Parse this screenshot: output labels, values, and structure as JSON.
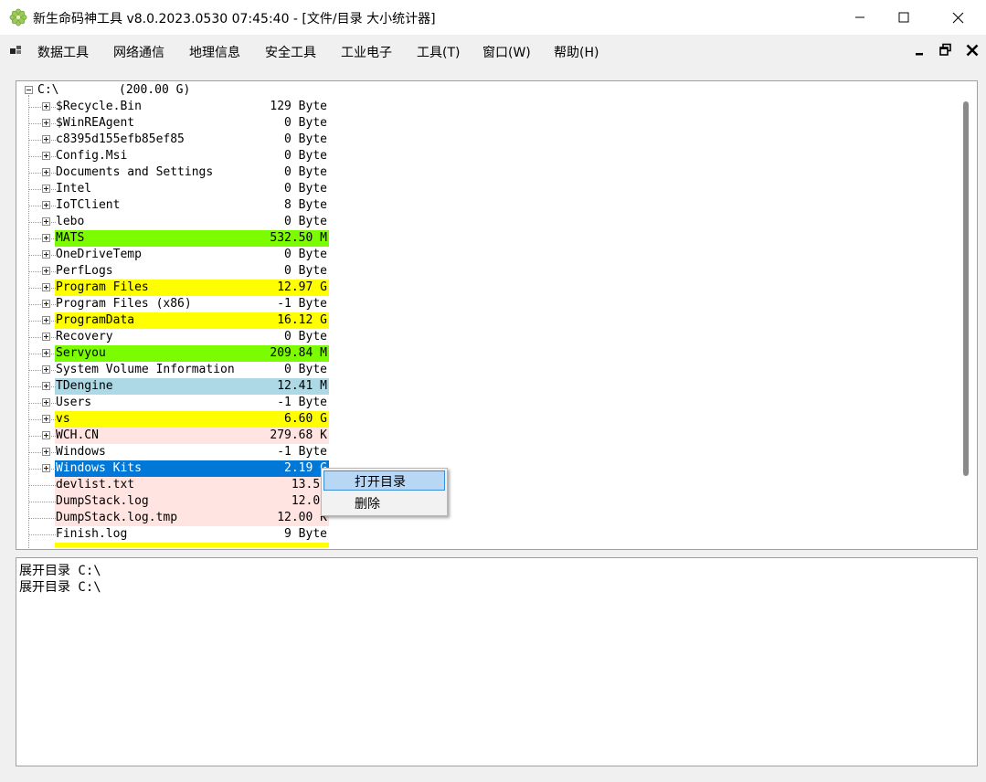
{
  "window": {
    "title": "新生命码神工具 v8.0.2023.0530 07:45:40 - [文件/目录 大小统计器]",
    "controls": [
      "minimize",
      "maximize",
      "close"
    ]
  },
  "menu": {
    "items": [
      "数据工具",
      "网络通信",
      "地理信息",
      "安全工具",
      "工业电子",
      "工具(T)",
      "窗口(W)",
      "帮助(H)"
    ]
  },
  "tree": {
    "root": {
      "name": "C:\\",
      "size": "(200.00 G)"
    },
    "items": [
      {
        "name": "$Recycle.Bin",
        "size": "129 Byte",
        "type": "dir",
        "highlight": ""
      },
      {
        "name": "$WinREAgent",
        "size": "0 Byte",
        "type": "dir",
        "highlight": ""
      },
      {
        "name": "c8395d155efb85ef85",
        "size": "0 Byte",
        "type": "dir",
        "highlight": ""
      },
      {
        "name": "Config.Msi",
        "size": "0 Byte",
        "type": "dir",
        "highlight": ""
      },
      {
        "name": "Documents and Settings",
        "size": "0 Byte",
        "type": "dir",
        "highlight": ""
      },
      {
        "name": "Intel",
        "size": "0 Byte",
        "type": "dir",
        "highlight": ""
      },
      {
        "name": "IoTClient",
        "size": "8 Byte",
        "type": "dir",
        "highlight": ""
      },
      {
        "name": "lebo",
        "size": "0 Byte",
        "type": "dir",
        "highlight": ""
      },
      {
        "name": "MATS",
        "size": "532.50 M",
        "type": "dir",
        "highlight": "#7cfc00"
      },
      {
        "name": "OneDriveTemp",
        "size": "0 Byte",
        "type": "dir",
        "highlight": ""
      },
      {
        "name": "PerfLogs",
        "size": "0 Byte",
        "type": "dir",
        "highlight": ""
      },
      {
        "name": "Program Files",
        "size": "12.97 G",
        "type": "dir",
        "highlight": "#ffff00"
      },
      {
        "name": "Program Files (x86)",
        "size": "-1 Byte",
        "type": "dir",
        "highlight": ""
      },
      {
        "name": "ProgramData",
        "size": "16.12 G",
        "type": "dir",
        "highlight": "#ffff00"
      },
      {
        "name": "Recovery",
        "size": "0 Byte",
        "type": "dir",
        "highlight": ""
      },
      {
        "name": "Servyou",
        "size": "209.84 M",
        "type": "dir",
        "highlight": "#7cfc00"
      },
      {
        "name": "System Volume Information",
        "size": "0 Byte",
        "type": "dir",
        "highlight": ""
      },
      {
        "name": "TDengine",
        "size": "12.41 M",
        "type": "dir",
        "highlight": "#add8e6"
      },
      {
        "name": "Users",
        "size": "-1 Byte",
        "type": "dir",
        "highlight": ""
      },
      {
        "name": "vs",
        "size": "6.60 G",
        "type": "dir",
        "highlight": "#ffff00"
      },
      {
        "name": "WCH.CN",
        "size": "279.68 K",
        "type": "dir",
        "highlight": "#ffe4e1"
      },
      {
        "name": "Windows",
        "size": "-1 Byte",
        "type": "dir",
        "highlight": ""
      },
      {
        "name": "Windows Kits",
        "size": "2.19 G",
        "type": "dir",
        "highlight": "#0078d7",
        "selected": true
      },
      {
        "name": "devlist.txt",
        "size": "13.58",
        "type": "file",
        "highlight": "#ffe4e1"
      },
      {
        "name": "DumpStack.log",
        "size": "12.00",
        "type": "file",
        "highlight": "#ffe4e1"
      },
      {
        "name": "DumpStack.log.tmp",
        "size": "12.00 K",
        "type": "file",
        "highlight": "#ffe4e1"
      },
      {
        "name": "Finish.log",
        "size": "9 Byte",
        "type": "file",
        "highlight": ""
      }
    ]
  },
  "context_menu": {
    "items": [
      {
        "label": "打开目录",
        "hover": true
      },
      {
        "label": "删除",
        "hover": false
      }
    ]
  },
  "log": {
    "lines": [
      "展开目录 C:\\",
      "展开目录 C:\\"
    ]
  }
}
